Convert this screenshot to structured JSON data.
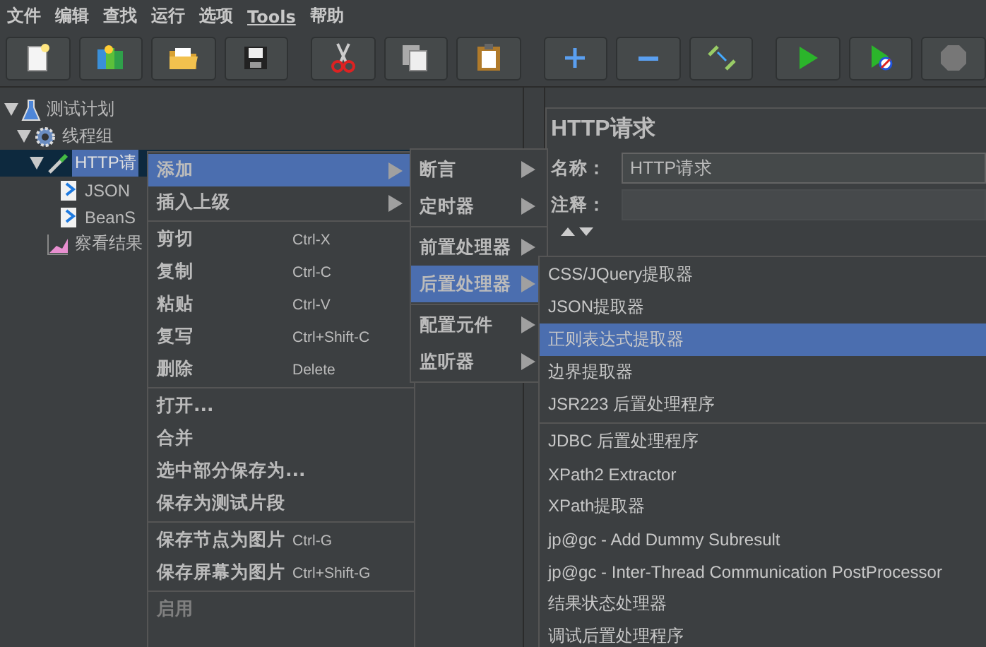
{
  "menu_bar": [
    {
      "label": "文件",
      "mnemonic_underline": false
    },
    {
      "label": "编辑",
      "mnemonic_underline": false
    },
    {
      "label": "查找",
      "mnemonic_underline": false
    },
    {
      "label": "运行",
      "mnemonic_underline": false
    },
    {
      "label": "选项",
      "mnemonic_underline": false
    },
    {
      "label": "Tools",
      "mnemonic_underline": true
    },
    {
      "label": "帮助",
      "mnemonic_underline": false
    }
  ],
  "toolbar": [
    {
      "kind": "new",
      "gap_before": false
    },
    {
      "kind": "templates",
      "gap_before": false
    },
    {
      "kind": "open",
      "gap_before": false
    },
    {
      "kind": "save",
      "gap_before": false
    },
    {
      "kind": "cut",
      "gap_before": true
    },
    {
      "kind": "copy",
      "gap_before": false
    },
    {
      "kind": "paste",
      "gap_before": false
    },
    {
      "kind": "expand",
      "gap_before": true
    },
    {
      "kind": "collapse",
      "gap_before": false
    },
    {
      "kind": "toggle",
      "gap_before": false
    },
    {
      "kind": "start",
      "gap_before": true
    },
    {
      "kind": "start-no-pause",
      "gap_before": false
    },
    {
      "kind": "stop",
      "gap_before": false
    }
  ],
  "tree": [
    {
      "label": "测试计划",
      "kind": "plan",
      "expanded": true,
      "selected": false,
      "children": [
        {
          "label": "线程组",
          "kind": "threads",
          "expanded": true,
          "selected": false,
          "children": [
            {
              "label": "HTTP请",
              "kind": "sampler",
              "expanded": true,
              "selected": true,
              "children": [
                {
                  "label": "JSON",
                  "kind": "post",
                  "selected": false
                },
                {
                  "label": "BeanS",
                  "kind": "post",
                  "selected": false
                }
              ]
            },
            {
              "label": "察看结果",
              "kind": "listener",
              "selected": false
            }
          ]
        }
      ]
    }
  ],
  "editor": {
    "title": "HTTP请求",
    "name_label": "名称：",
    "name_value": "HTTP请求",
    "comment_label": "注释："
  },
  "context_menu": {
    "groups": [
      [
        {
          "label": "添加",
          "submenu": true,
          "selected": true,
          "disabled": false
        },
        {
          "label": "插入上级",
          "submenu": true,
          "selected": false,
          "disabled": false
        }
      ],
      [
        {
          "label": "剪切",
          "shortcut": "Ctrl-X",
          "selected": false,
          "disabled": false
        },
        {
          "label": "复制",
          "shortcut": "Ctrl-C",
          "selected": false,
          "disabled": false
        },
        {
          "label": "粘贴",
          "shortcut": "Ctrl-V",
          "selected": false,
          "disabled": false
        },
        {
          "label": "复写",
          "shortcut": "Ctrl+Shift-C",
          "selected": false,
          "disabled": false
        },
        {
          "label": "删除",
          "shortcut": "Delete",
          "selected": false,
          "disabled": false
        }
      ],
      [
        {
          "label": "打开...",
          "selected": false,
          "disabled": false
        },
        {
          "label": "合并",
          "selected": false,
          "disabled": false
        },
        {
          "label": "选中部分保存为...",
          "selected": false,
          "disabled": false
        },
        {
          "label": "保存为测试片段",
          "selected": false,
          "disabled": false
        }
      ],
      [
        {
          "label": "保存节点为图片",
          "shortcut": "Ctrl-G",
          "selected": false,
          "disabled": false
        },
        {
          "label": "保存屏幕为图片",
          "shortcut": "Ctrl+Shift-G",
          "selected": false,
          "disabled": false
        }
      ],
      [
        {
          "label": "启用",
          "selected": false,
          "disabled": true
        }
      ]
    ]
  },
  "add_submenu": {
    "groups": [
      [
        {
          "label": "断言",
          "submenu": true,
          "selected": false
        },
        {
          "label": "定时器",
          "submenu": true,
          "selected": false
        }
      ],
      [
        {
          "label": "前置处理器",
          "submenu": true,
          "selected": false
        },
        {
          "label": "后置处理器",
          "submenu": true,
          "selected": true
        }
      ],
      [
        {
          "label": "配置元件",
          "submenu": true,
          "selected": false
        },
        {
          "label": "监听器",
          "submenu": true,
          "selected": false
        }
      ]
    ]
  },
  "post_processor_submenu": {
    "groups": [
      [
        {
          "label": "CSS/JQuery提取器",
          "selected": false
        },
        {
          "label": "JSON提取器",
          "selected": false
        },
        {
          "label": "正则表达式提取器",
          "selected": true
        },
        {
          "label": "边界提取器",
          "selected": false
        },
        {
          "label": "JSR223 后置处理程序",
          "selected": false
        }
      ],
      [
        {
          "label": "JDBC 后置处理程序",
          "selected": false
        },
        {
          "label": "XPath2 Extractor",
          "selected": false
        },
        {
          "label": "XPath提取器",
          "selected": false
        },
        {
          "label": "jp@gc - Add Dummy Subresult",
          "selected": false
        },
        {
          "label": "jp@gc - Inter-Thread Communication PostProcessor",
          "selected": false
        },
        {
          "label": "结果状态处理器",
          "selected": false
        },
        {
          "label": "调试后置处理程序",
          "selected": false
        }
      ]
    ]
  }
}
